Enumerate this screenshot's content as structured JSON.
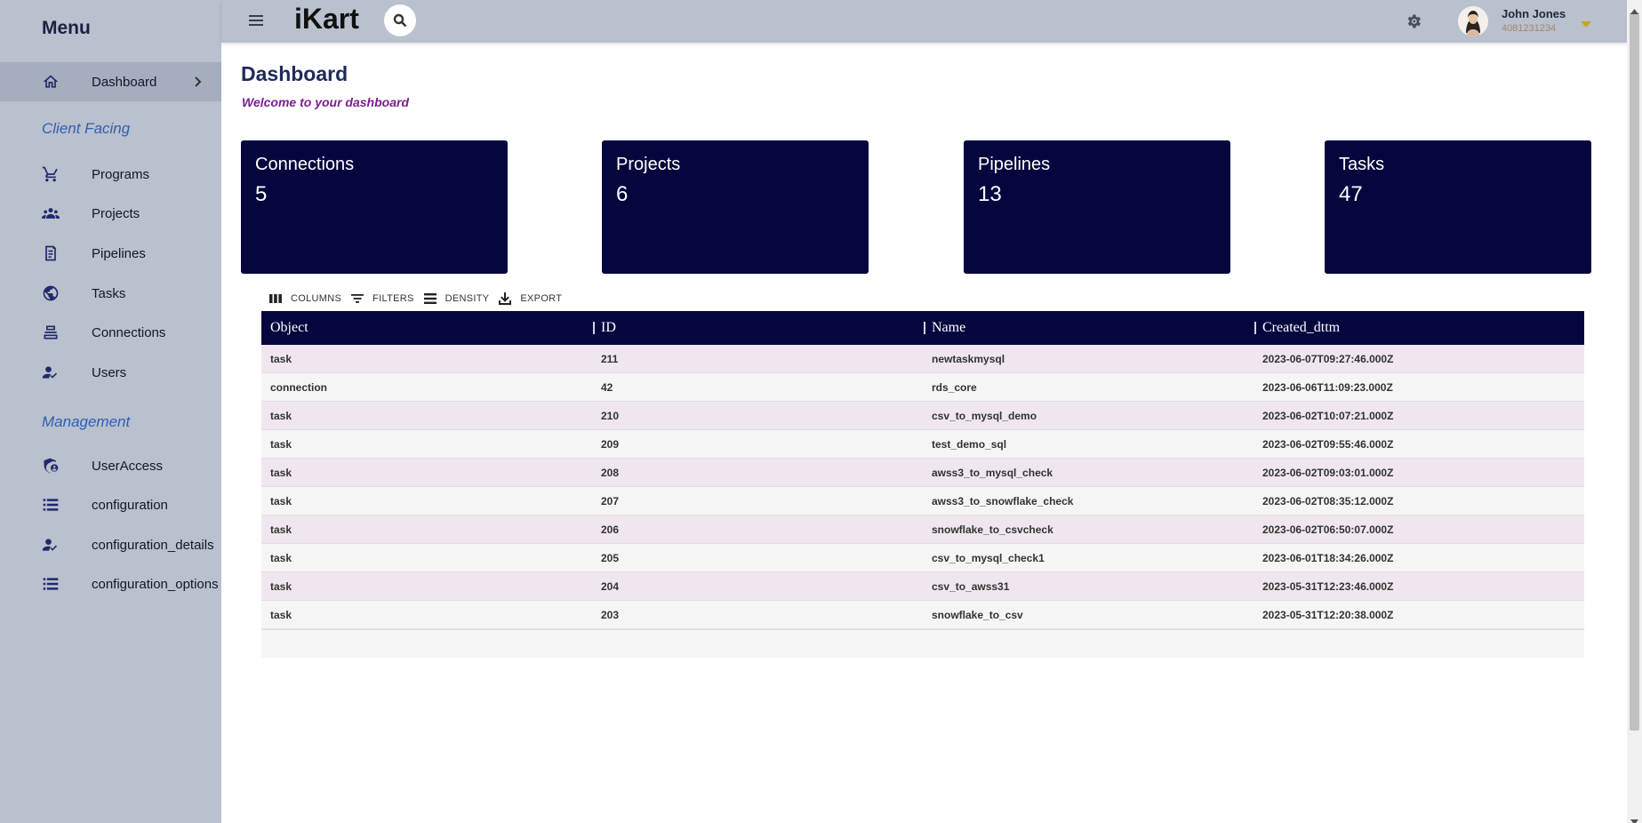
{
  "sidebar": {
    "menu_title": "Menu",
    "dashboard": "Dashboard",
    "section_client": "Client Facing",
    "section_management": "Management",
    "client_items": [
      {
        "label": "Programs",
        "icon": "cart-icon"
      },
      {
        "label": "Projects",
        "icon": "groups-icon"
      },
      {
        "label": "Pipelines",
        "icon": "receipt-icon"
      },
      {
        "label": "Tasks",
        "icon": "globe-icon"
      },
      {
        "label": "Connections",
        "icon": "stack-icon"
      },
      {
        "label": "Users",
        "icon": "user-check-icon"
      }
    ],
    "management_items": [
      {
        "label": "UserAccess",
        "icon": "shield-person-icon"
      },
      {
        "label": "configuration",
        "icon": "list-icon"
      },
      {
        "label": "configuration_details",
        "icon": "user-check-icon"
      },
      {
        "label": "configuration_options",
        "icon": "list-icon"
      }
    ]
  },
  "topbar": {
    "brand": "iKart",
    "user_name": "John Jones",
    "user_phone": "4081231234"
  },
  "main": {
    "title": "Dashboard",
    "subtitle": "Welcome to your dashboard",
    "cards": [
      {
        "title": "Connections",
        "value": "5"
      },
      {
        "title": "Projects",
        "value": "6"
      },
      {
        "title": "Pipelines",
        "value": "13"
      },
      {
        "title": "Tasks",
        "value": "47"
      }
    ],
    "toolbar": {
      "columns": "COLUMNS",
      "filters": "FILTERS",
      "density": "DENSITY",
      "export": "EXPORT"
    },
    "table": {
      "columns": [
        "Object",
        "ID",
        "Name",
        "Created_dttm"
      ],
      "rows": [
        [
          "task",
          "211",
          "newtaskmysql",
          "2023-06-07T09:27:46.000Z"
        ],
        [
          "connection",
          "42",
          "rds_core",
          "2023-06-06T11:09:23.000Z"
        ],
        [
          "task",
          "210",
          "csv_to_mysql_demo",
          "2023-06-02T10:07:21.000Z"
        ],
        [
          "task",
          "209",
          "test_demo_sql",
          "2023-06-02T09:55:46.000Z"
        ],
        [
          "task",
          "208",
          "awss3_to_mysql_check",
          "2023-06-02T09:03:01.000Z"
        ],
        [
          "task",
          "207",
          "awss3_to_snowflake_check",
          "2023-06-02T08:35:12.000Z"
        ],
        [
          "task",
          "206",
          "snowflake_to_csvcheck",
          "2023-06-02T06:50:07.000Z"
        ],
        [
          "task",
          "205",
          "csv_to_mysql_check1",
          "2023-06-01T18:34:26.000Z"
        ],
        [
          "task",
          "204",
          "csv_to_awss31",
          "2023-05-31T12:23:46.000Z"
        ],
        [
          "task",
          "203",
          "snowflake_to_csv",
          "2023-05-31T12:20:38.000Z"
        ]
      ]
    }
  },
  "colors": {
    "sidebar_bg": "#b9c0ce",
    "card_bg": "#06063f",
    "section_label": "#2f5fb3",
    "subtitle": "#7a1f8f",
    "row_stripe": "#efe6ef"
  }
}
